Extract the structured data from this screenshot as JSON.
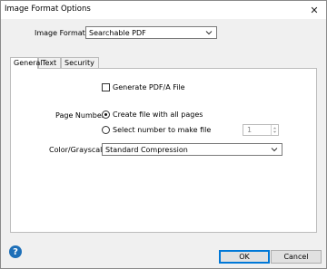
{
  "window": {
    "title": "Image Format Options",
    "close_glyph": "✕"
  },
  "image_format": {
    "label": "Image Format :",
    "value": "Searchable PDF"
  },
  "tabs": [
    {
      "label": "General",
      "active": true
    },
    {
      "label": "Text",
      "active": false
    },
    {
      "label": "Security",
      "active": false
    }
  ],
  "general": {
    "pdfa_label": "Generate PDF/A File",
    "pdfa_checked": false,
    "page_number_label": "Page Number :",
    "option_all_pages": "Create file with all pages",
    "option_select_number": "Select number to make file",
    "selected_option": "all_pages",
    "spin_value": "1",
    "color_label": "Color/Grayscale :",
    "color_value": "Standard Compression"
  },
  "buttons": {
    "ok": "OK",
    "cancel": "Cancel",
    "help_glyph": "?"
  },
  "icons": {
    "help": "help-icon",
    "close": "close-icon",
    "dropdown": "chevron-down-icon"
  },
  "colors": {
    "accent": "#0078d7",
    "help": "#1d6fb8"
  }
}
